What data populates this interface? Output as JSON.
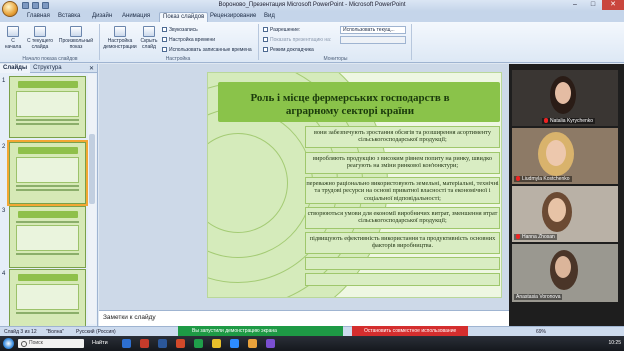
{
  "window": {
    "title": "Вороново_Презентация Microsoft PowerPoint - Microsoft PowerPoint"
  },
  "tabs": [
    "Главная",
    "Вставка",
    "Дизайн",
    "Анимация",
    "Показ слайдов",
    "Рецензирование",
    "Вид"
  ],
  "active_tab": "Показ слайдов",
  "ribbon": {
    "start_group": {
      "from_start": "С начала",
      "from_current": "С текущего слайда",
      "custom_show": "Произвольный показ",
      "label": "Начало показа слайдов"
    },
    "setup_group": {
      "setup_show": "Настройка демонстрации",
      "hide_slide": "Скрыть слайд",
      "sound": "Звукозапись",
      "rehearse": "Настройка времени",
      "use_timings": "Использовать записанные времена",
      "label": "Настройка"
    },
    "monitors_group": {
      "resolution": "Разрешение:",
      "resolution_value": "Использовать текущ...",
      "show_on": "Показать презентацию на:",
      "presenter_view": "Режим докладчика",
      "label": "Мониторы"
    }
  },
  "left_pane": {
    "tab_slides": "Слайды",
    "tab_outline": "Структура",
    "thumb_numbers": [
      "1",
      "2",
      "3",
      "4"
    ]
  },
  "slide": {
    "title": "Роль і місце фермерських господарств в аграрному секторі країни",
    "items": [
      "вони забезпечують зростання обсягів та розширення асортименту сільськогосподарської продукції;",
      "виробляють продукцію з високим рівнем попиту на ринку, швидко реагують на зміни ринкової кон'юнктури;",
      "переважно раціонально використовують земельні, матеріальні, технічні та трудові ресурси на основі приватної власності та економічної і соціальної відповідальності;",
      "створюються умови для економії виробничих витрат, зменшення втрат сільськогосподарської продукції;",
      "підвищують ефективність використання та продуктивність основних факторів виробництва."
    ]
  },
  "notes": {
    "placeholder": "Заметки к слайду"
  },
  "participants": [
    "Natalia Kyrychenko",
    "Liudmyla Kostchenko",
    "Hanna Zhosan",
    "Anastasia Voronova"
  ],
  "status": {
    "slide": "Слайд 3 из 12",
    "theme": "\"Волна\"",
    "language": "Русский (Россия)",
    "share_banner": "Вы запустили демонстрацию экрана",
    "stop_button": "Остановить совместное использование",
    "zoom": "69%"
  },
  "taskbar": {
    "search_placeholder": "Поиск",
    "app_label": "Найти",
    "time": "10:25"
  },
  "colors": {
    "accent": "#8ac34a",
    "slide_bg": "#eef7e2",
    "share_green": "#1e9a45",
    "stop_red": "#d42e2e"
  }
}
